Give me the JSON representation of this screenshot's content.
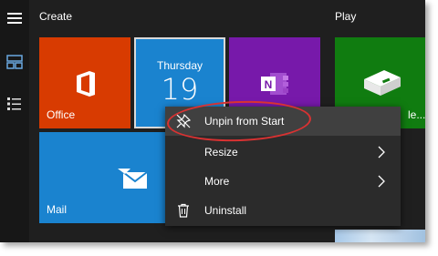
{
  "groups": {
    "create_label": "Create",
    "play_label": "Play"
  },
  "tiles": {
    "office": {
      "label": "Office",
      "color": "#d83b01",
      "icon": "office-icon"
    },
    "calendar": {
      "day": "Thursday",
      "date": "19",
      "color": "#1a83cf"
    },
    "onenote": {
      "color": "#7719aa",
      "icon": "onenote-icon"
    },
    "xbox": {
      "label": "le...",
      "color": "#107c10",
      "icon": "xbox-console-icon"
    },
    "mail": {
      "label": "Mail",
      "color": "#1a83cf",
      "icon": "mail-icon"
    }
  },
  "rail": {
    "icons": [
      "hamburger-icon",
      "tiles-view-icon",
      "list-view-icon"
    ]
  },
  "context_menu": {
    "items": [
      {
        "label": "Unpin from Start",
        "icon": "unpin-icon",
        "submenu": false,
        "highlighted": true
      },
      {
        "label": "Resize",
        "icon": "",
        "submenu": true,
        "highlighted": false
      },
      {
        "label": "More",
        "icon": "",
        "submenu": true,
        "highlighted": false
      },
      {
        "label": "Uninstall",
        "icon": "trash-icon",
        "submenu": false,
        "highlighted": false
      }
    ]
  },
  "colors": {
    "start_bg": "#1f1f1f",
    "menu_bg": "#2b2b2b",
    "menu_highlight": "#404040",
    "annotation": "#d93232"
  }
}
